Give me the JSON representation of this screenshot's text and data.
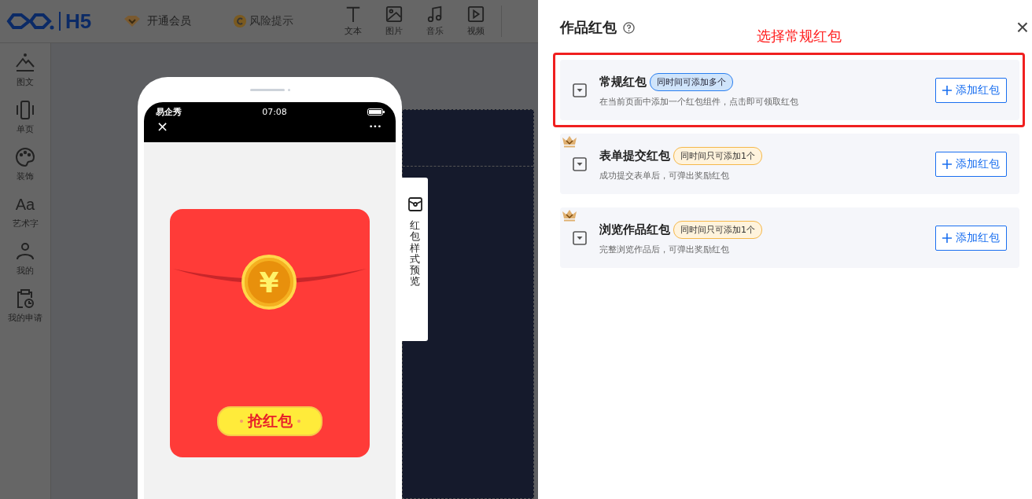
{
  "logo": {
    "text": "H5"
  },
  "topbar": {
    "member": "开通会员",
    "risk": "风险提示",
    "tools": [
      {
        "kind": "text",
        "label": "文本"
      },
      {
        "kind": "image",
        "label": "图片"
      },
      {
        "kind": "music",
        "label": "音乐"
      },
      {
        "kind": "video",
        "label": "视频"
      }
    ]
  },
  "sidebar": {
    "items": [
      {
        "kind": "mountain",
        "label": "图文"
      },
      {
        "kind": "page",
        "label": "单页"
      },
      {
        "kind": "palette",
        "label": "装饰"
      },
      {
        "kind": "font",
        "label": "艺术字",
        "icon_text": "Aa"
      },
      {
        "kind": "person",
        "label": "我的"
      },
      {
        "kind": "clipboard",
        "label": "我的申请"
      }
    ]
  },
  "phone": {
    "carrier": "易企秀",
    "time": "07:08",
    "close": "×",
    "more": "•••",
    "packet": {
      "symbol": "¥",
      "button": "抢红包"
    }
  },
  "preview_tab": {
    "label": "红包样式预览"
  },
  "panel": {
    "title": "作品红包",
    "annotation": "选择常规红包",
    "close": "×",
    "cards": [
      {
        "title": "常规红包",
        "badge": "同时间可添加多个",
        "kind": "multi",
        "premium": false,
        "highlighted": true,
        "description": "在当前页面中添加一个红包组件，点击即可领取红包",
        "button": "添加红包"
      },
      {
        "title": "表单提交红包",
        "badge": "同时间只可添加1个",
        "kind": "single",
        "premium": true,
        "highlighted": false,
        "description": "成功提交表单后，可弹出奖励红包",
        "button": "添加红包"
      },
      {
        "title": "浏览作品红包",
        "badge": "同时间只可添加1个",
        "kind": "single",
        "premium": true,
        "highlighted": false,
        "description": "完整浏览作品后，可弹出奖励红包",
        "button": "添加红包"
      }
    ]
  }
}
